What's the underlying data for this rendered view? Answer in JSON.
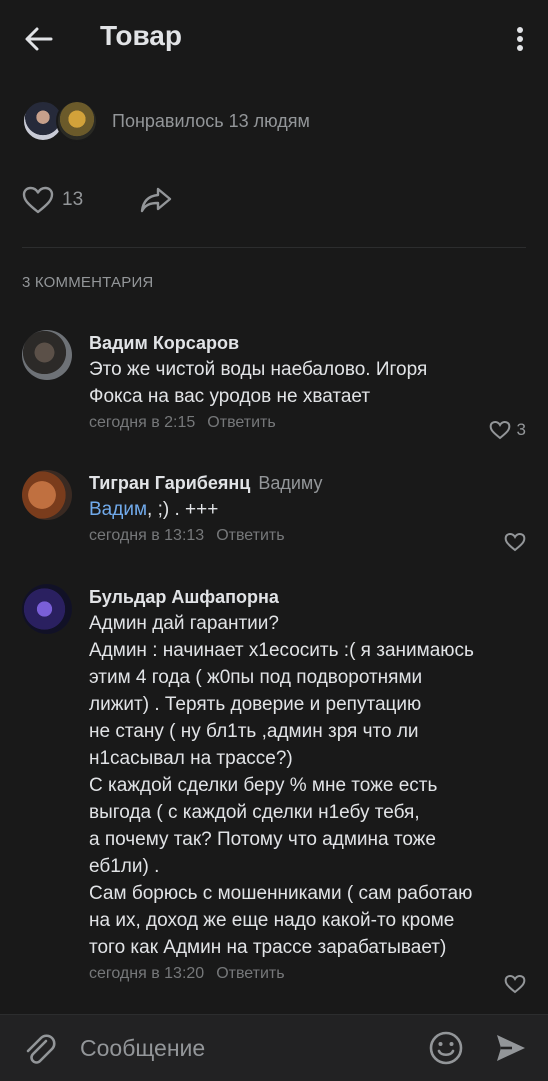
{
  "header": {
    "title": "Товар",
    "back_icon": "arrow-left-icon",
    "menu_icon": "more-vertical-icon"
  },
  "likes": {
    "text": "Понравилось 13 людям"
  },
  "actions": {
    "like_count": "13"
  },
  "comments": {
    "header": "3 КОММЕНТАРИЯ",
    "items": [
      {
        "author": "Вадим Корсаров",
        "text": "Это же чистой воды наебалово. Игоря\nФокса на вас уродов не хватает",
        "time": "сегодня в 2:15",
        "reply_label": "Ответить",
        "likes": "3"
      },
      {
        "author": "Тигран Гарибеянц",
        "reply_to": "Вадиму",
        "link": "Вадим",
        "text": ", ;) . +++",
        "time": "сегодня в 13:13",
        "reply_label": "Ответить"
      },
      {
        "author": "Бульдар Ашфапорна",
        "text": "Админ дай гарантии?\nАдмин : начинает х1есосить :( я занимаюсь\nэтим 4 года ( ж0пы под подворотнями\nлижит) . Терять доверие и репутацию\nне стану ( ну бл1ть ,админ зря что ли\nн1сасывал на трассе?)\nС каждой сделки беру % мне тоже есть\nвыгода ( с каждой сделки н1ебу тебя,\nа почему так? Потому что админа тоже\nеб1ли) .\nСам борюсь с мошенниками ( сам работаю\nна их, доход же еще надо какой-то кроме\nтого как Админ на трассе зарабатывает)",
        "time": "сегодня в 13:20",
        "reply_label": "Ответить"
      }
    ]
  },
  "input": {
    "placeholder": "Сообщение"
  },
  "colors": {
    "background": "#191919",
    "text": "#e1e3e6",
    "secondary": "#939699",
    "link": "#71aaeb"
  }
}
